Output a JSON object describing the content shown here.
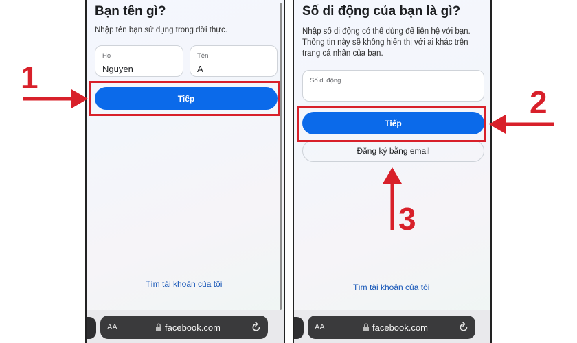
{
  "left_screen": {
    "title": "Bạn tên gì?",
    "description": "Nhập tên bạn sử dụng trong đời thực.",
    "last_name_field": {
      "label": "Họ",
      "value": "Nguyen"
    },
    "first_name_field": {
      "label": "Tên",
      "value": "A"
    },
    "next_button": "Tiếp",
    "find_account_link": "Tìm tài khoản của tôi"
  },
  "right_screen": {
    "title": "Số di động của bạn là gì?",
    "description_lines": [
      "Nhập số di động có thể dùng để liên hệ với bạn.",
      "Thông tin này sẽ không hiển thị với ai khác trên",
      "trang cá nhân của bạn."
    ],
    "phone_field": {
      "label": "Số di động",
      "value": ""
    },
    "next_button": "Tiếp",
    "email_button": "Đăng ký bằng email",
    "find_account_link": "Tìm tài khoản của tôi"
  },
  "browser": {
    "text_size_label": "AA",
    "url": "facebook.com",
    "icons": [
      "lock-icon",
      "reload-icon"
    ]
  },
  "annotations": {
    "step_numbers": [
      "1",
      "2",
      "3"
    ],
    "highlight_color": "#d8202a"
  },
  "colors": {
    "primary_button": "#0b6aea",
    "link": "#1857b8"
  }
}
